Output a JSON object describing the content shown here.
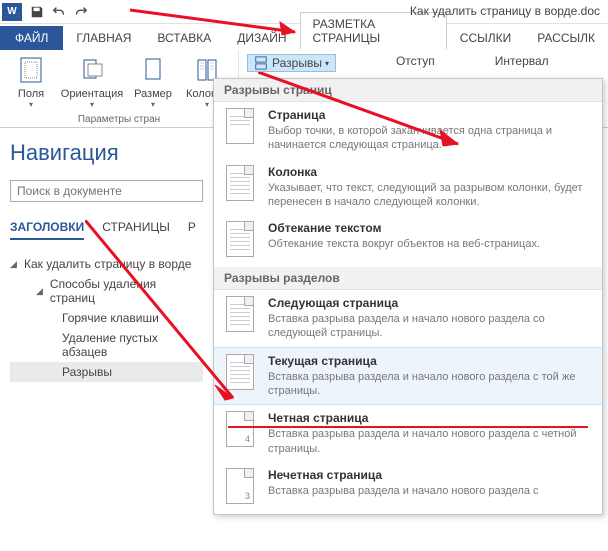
{
  "titlebar": {
    "doc_title": "Как удалить страницу в ворде.doc"
  },
  "tabs": {
    "file": "ФАЙЛ",
    "home": "ГЛАВНАЯ",
    "insert": "ВСТАВКА",
    "design": "ДИЗАЙН",
    "layout": "РАЗМЕТКА СТРАНИЦЫ",
    "references": "ССЫЛКИ",
    "mailings": "РАССЫЛК"
  },
  "ribbon": {
    "margins": "Поля",
    "orientation": "Ориентация",
    "size": "Размер",
    "columns": "Колонки",
    "group_label": "Параметры стран",
    "breaks": "Разрывы",
    "indent": "Отступ",
    "spacing": "Интервал"
  },
  "dropdown": {
    "section1_title": "Разрывы страниц",
    "items1": [
      {
        "title": "Страница",
        "desc": "Выбор точки, в которой заканчивается одна страница и начинается следующая страница."
      },
      {
        "title": "Колонка",
        "desc": "Указывает, что текст, следующий за разрывом колонки, будет перенесен в начало следующей колонки."
      },
      {
        "title": "Обтекание текстом",
        "desc": "Обтекание текста вокруг объектов на веб-страницах."
      }
    ],
    "section2_title": "Разрывы разделов",
    "items2": [
      {
        "title": "Следующая страница",
        "desc": "Вставка разрыва раздела и начало нового раздела со следующей страницы."
      },
      {
        "title": "Текущая страница",
        "desc": "Вставка разрыва раздела и начало нового раздела с той же страницы."
      },
      {
        "title": "Четная страница",
        "desc": "Вставка разрыва раздела и начало нового раздела с четной страницы."
      },
      {
        "title": "Нечетная страница",
        "desc": "Вставка разрыва раздела и начало нового раздела с"
      }
    ]
  },
  "nav": {
    "title": "Навигация",
    "search_placeholder": "Поиск в документе",
    "tabs": {
      "headings": "ЗАГОЛОВКИ",
      "pages": "СТРАНИЦЫ",
      "results": "Р"
    },
    "tree": {
      "root": "Как удалить страницу в ворде",
      "child1": "Способы удаления страниц",
      "leaf1": "Горячие клавиши",
      "leaf2": "Удаление пустых абзацев",
      "leaf3": "Разрывы"
    }
  }
}
